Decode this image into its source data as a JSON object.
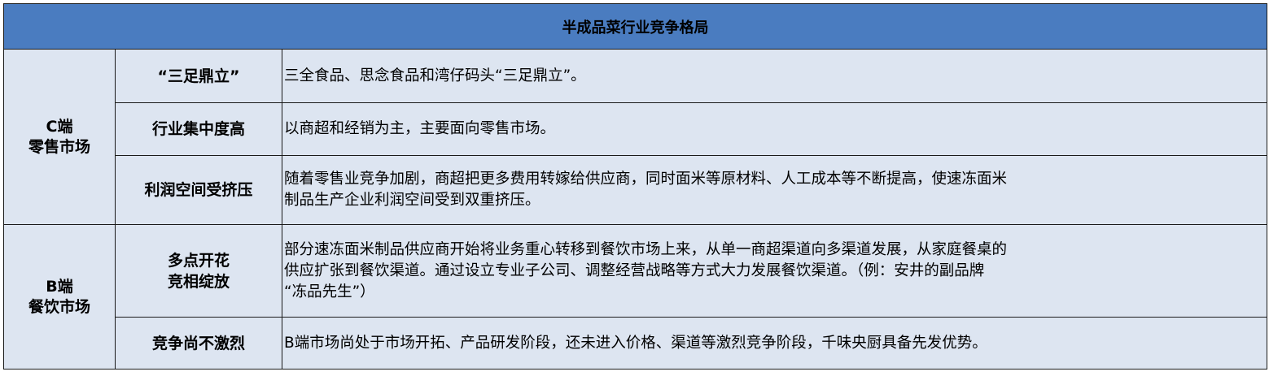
{
  "title": "半成品菜行业竞争格局",
  "groups": [
    {
      "line1": "C端",
      "line2": "零售市场",
      "rows": [
        {
          "label": [
            "“三足鼎立”"
          ],
          "desc": [
            "三全食品、思念食品和湾仔码头“三足鼎立”。"
          ]
        },
        {
          "label": [
            "行业集中度高"
          ],
          "desc": [
            "以商超和经销为主，主要面向零售市场。"
          ]
        },
        {
          "label": [
            "利润空间受挤压"
          ],
          "desc": [
            "随着零售业竞争加剧，商超把更多费用转嫁给供应商，同时面米等原材料、人工成本等不断提高，使速冻面米",
            "制品生产企业利润空间受到双重挤压。"
          ]
        }
      ]
    },
    {
      "line1": "B端",
      "line2": "餐饮市场",
      "rows": [
        {
          "label": [
            "多点开花",
            "竞相绽放"
          ],
          "desc": [
            "部分速冻面米制品供应商开始将业务重心转移到餐饮市场上来，从单一商超渠道向多渠道发展，从家庭餐桌的",
            "供应扩张到餐饮渠道。通过设立专业子公司、调整经营战略等方式大力发展餐饮渠道。（例：安井的副品牌",
            "“冻品先生”）"
          ]
        },
        {
          "label": [
            "竞争尚不激烈"
          ],
          "desc": [
            "B端市场尚处于市场开拓、产品研发阶段，还未进入价格、渠道等激烈竞争阶段，千味央厨具备先发优势。"
          ]
        }
      ]
    }
  ]
}
